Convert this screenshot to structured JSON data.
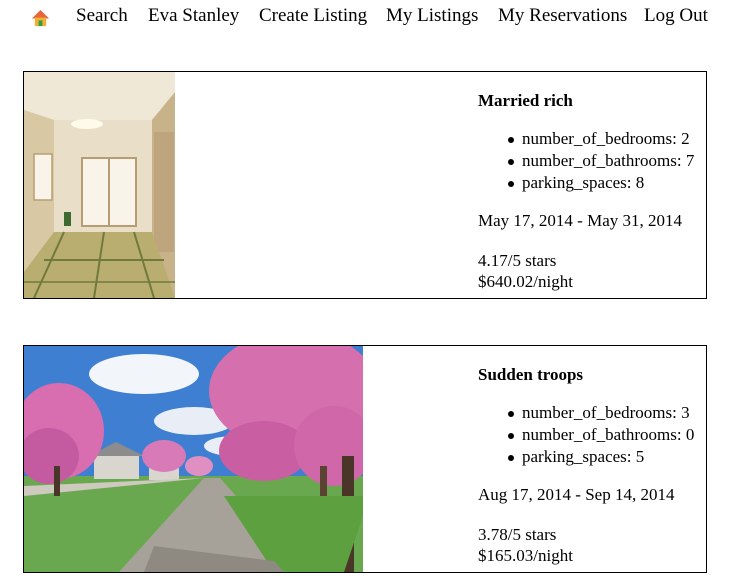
{
  "nav": {
    "home_icon": "home-icon",
    "links": [
      "Search",
      "Eva Stanley",
      "Create Listing",
      "My Listings",
      "My Reservations",
      "Log Out"
    ]
  },
  "listings": [
    {
      "title": "Married rich",
      "features": [
        "number_of_bedrooms: 2",
        "number_of_bathrooms: 7",
        "parking_spaces: 8"
      ],
      "dates": "May 17, 2014 - May 31, 2014",
      "rating": "4.17/5 stars",
      "price": "$640.02/night",
      "image": "tatami-room-photo"
    },
    {
      "title": "Sudden troops",
      "features": [
        "number_of_bedrooms: 3",
        "number_of_bathrooms: 0",
        "parking_spaces: 5"
      ],
      "dates": "Aug 17, 2014 - Sep 14, 2014",
      "rating": "3.78/5 stars",
      "price": "$165.03/night",
      "image": "cherry-blossom-street-photo"
    }
  ]
}
